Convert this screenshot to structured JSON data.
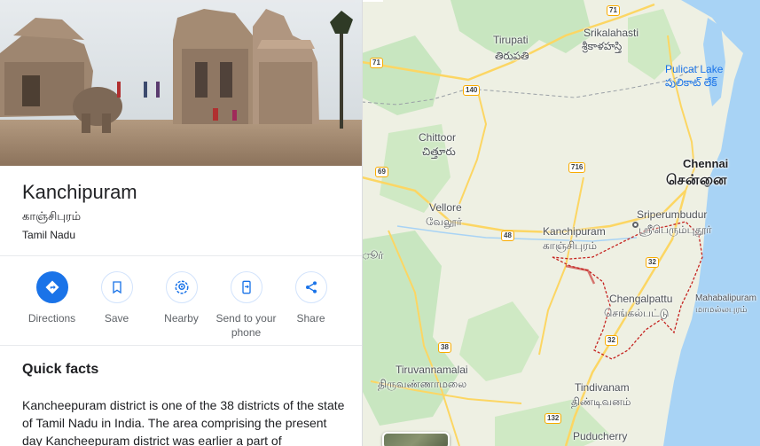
{
  "place": {
    "title": "Kanchipuram",
    "native_name": "காஞ்சிபுரம்",
    "region": "Tamil Nadu"
  },
  "actions": [
    {
      "label": "Directions",
      "icon": "directions-icon"
    },
    {
      "label": "Save",
      "icon": "bookmark-icon"
    },
    {
      "label": "Nearby",
      "icon": "nearby-icon"
    },
    {
      "label": "Send to your phone",
      "icon": "phone-icon"
    },
    {
      "label": "Share",
      "icon": "share-icon"
    }
  ],
  "quick_facts": {
    "heading": "Quick facts",
    "text": "Kancheepuram district is one of the 38 districts of the state of Tamil Nadu in India. The area comprising the present day Kancheepuram district was earlier a part of"
  },
  "map": {
    "labels": {
      "srikalahasti": "Srikalahasti",
      "srikalahasti_te": "శ్రీకాళహస్తి",
      "tirupati": "Tirupati",
      "tirupati_te": "తిరుపతి",
      "pulicat": "Pulicat Lake",
      "pulicat_te": "పులికాట్ లేక్",
      "chittoor": "Chittoor",
      "chittoor_te": "చిత్తూరు",
      "chennai": "Chennai",
      "chennai_ta": "சென்னை",
      "vellore": "Vellore",
      "vellore_ta": "வேலூர்",
      "kanchipuram": "Kanchipuram",
      "kanchipuram_ta": "காஞ்சிபுரம்",
      "sriperumbudur": "Sriperumbudur",
      "sriperumbudur_ta": "ஸ்ரீபெரும்புதூர்",
      "chengalpattu": "Chengalpattu",
      "chengalpattu_ta": "செங்கல்பட்டு",
      "mahabalipuram": "Mahabalipuram",
      "mahabalipuram_ta": "மாமல்லபுரம்",
      "tiruvannamalai": "Tiruvannamalai",
      "tiruvannamalai_ta": "திருவண்ணாமலை",
      "tindivanam": "Tindivanam",
      "tindivanam_ta": "திண்டிவனம்",
      "puducherry": "Puducherry",
      "edge_ta": "ூர்"
    },
    "highway_shields": [
      "71",
      "71",
      "140",
      "69",
      "716",
      "48",
      "32",
      "38",
      "32",
      "132"
    ],
    "colors": {
      "land": "#eef0e3",
      "green": "#c8e6c0",
      "water": "#a8d3f5",
      "border": "#c5221f",
      "road": "#fcd663"
    }
  }
}
